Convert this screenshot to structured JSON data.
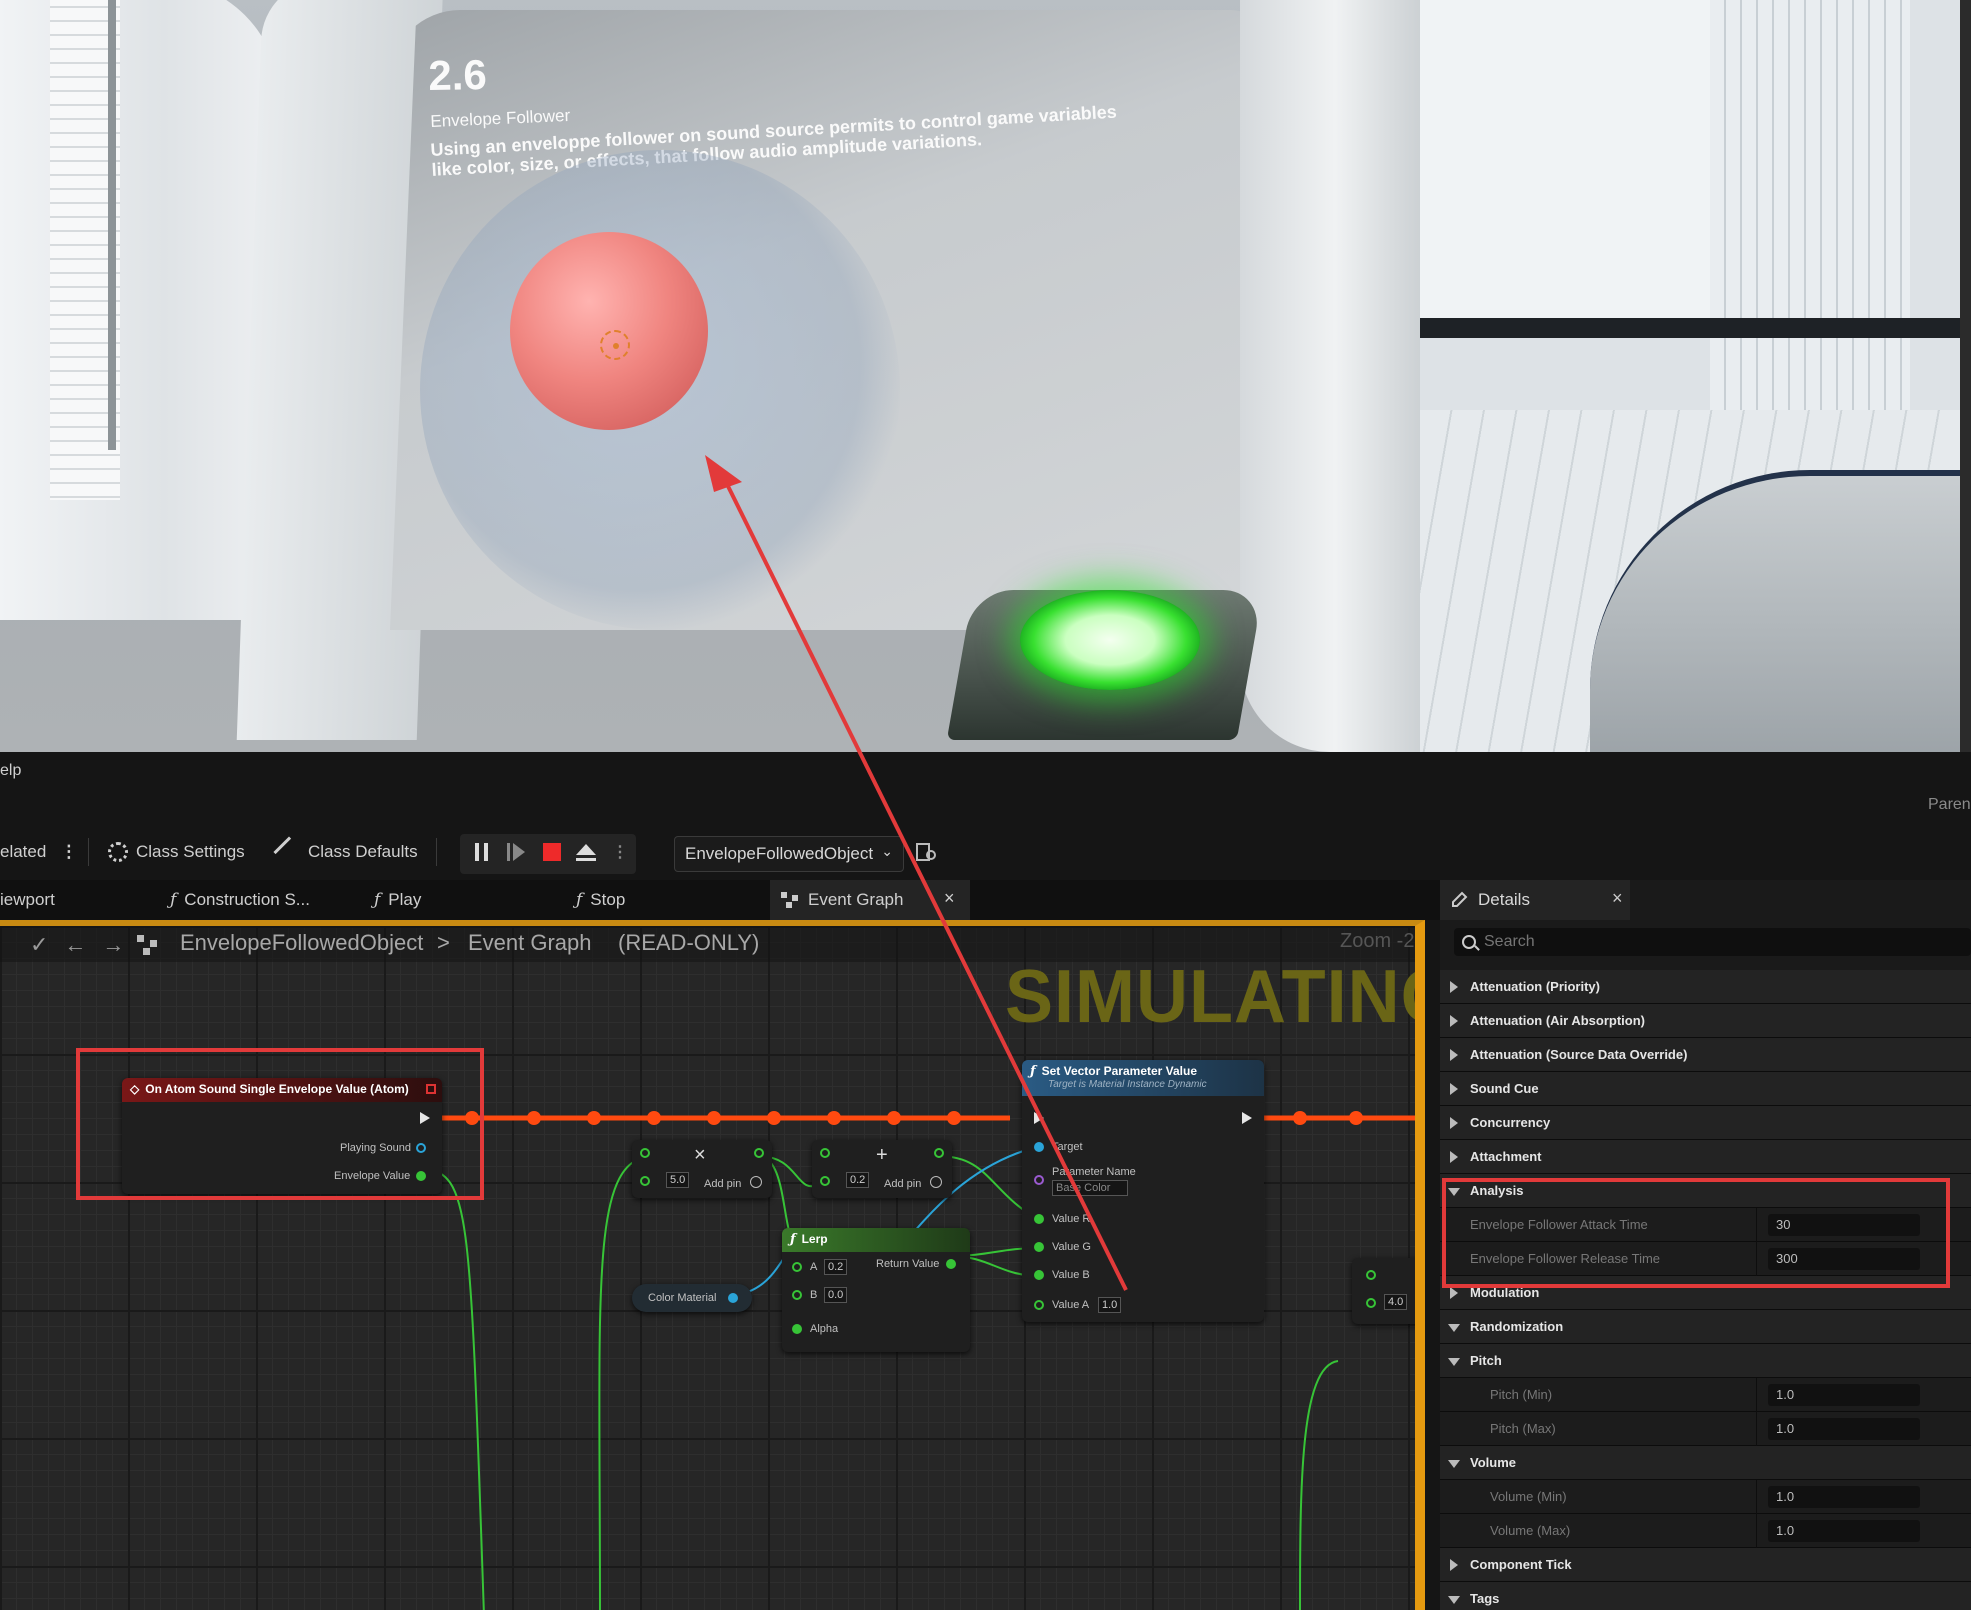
{
  "scene": {
    "number": "2.6",
    "title": "Envelope Follower",
    "description": "Using an enveloppe follower on sound source permits to control game variables like color, size, or effects, that follow audio amplitude variations."
  },
  "menu": {
    "help": "elp",
    "parent": "Paren"
  },
  "toolbar": {
    "related": "elated",
    "class_settings": "Class Settings",
    "class_defaults": "Class Defaults",
    "debug_object": "EnvelopeFollowedObject"
  },
  "tabs": [
    {
      "label": "iewport",
      "icon": "viewport-icon"
    },
    {
      "label": "Construction S...",
      "icon": "function-icon"
    },
    {
      "label": "Play",
      "icon": "function-icon"
    },
    {
      "label": "Stop",
      "icon": "function-icon"
    },
    {
      "label": "Event Graph",
      "icon": "graph-icon",
      "active": true
    }
  ],
  "breadcrumb": {
    "blueprint": "EnvelopeFollowedObject",
    "separator": ">",
    "graph": "Event Graph",
    "mode": "(READ-ONLY)",
    "zoom": "Zoom -2"
  },
  "graph": {
    "simulating_label": "SIMULATING",
    "nodes": {
      "event": {
        "title": "On Atom Sound Single Envelope Value (Atom)",
        "pins": [
          "Playing Sound",
          "Envelope Value"
        ]
      },
      "multiply": {
        "symbol": "×",
        "value": "5.0",
        "add_pin": "Add pin"
      },
      "add": {
        "symbol": "+",
        "value": "0.2",
        "add_pin": "Add pin"
      },
      "lerp": {
        "title": "Lerp",
        "pins": {
          "a": "A",
          "a_val": "0.2",
          "b": "B",
          "b_val": "0.0",
          "alpha": "Alpha",
          "ret": "Return Value"
        }
      },
      "color_material": {
        "label": "Color Material"
      },
      "set_vector": {
        "title": "Set Vector Parameter Value",
        "subtitle": "Target is Material Instance Dynamic",
        "pins": {
          "target": "Target",
          "param_name": "Parameter Name",
          "param_value": "Base Color",
          "r": "Value R",
          "g": "Value G",
          "b": "Value B",
          "a": "Value A",
          "a_val": "1.0"
        }
      },
      "partial": {
        "value": "4.0"
      }
    }
  },
  "details": {
    "tab_label": "Details",
    "search_placeholder": "Search",
    "rows": [
      {
        "type": "cat",
        "label": "Attenuation (Priority)",
        "open": false
      },
      {
        "type": "cat",
        "label": "Attenuation (Air Absorption)",
        "open": false
      },
      {
        "type": "cat",
        "label": "Attenuation (Source Data Override)",
        "open": false
      },
      {
        "type": "cat",
        "label": "Sound Cue",
        "open": false
      },
      {
        "type": "cat",
        "label": "Concurrency",
        "open": false
      },
      {
        "type": "cat",
        "label": "Attachment",
        "open": false
      },
      {
        "type": "cat",
        "label": "Analysis",
        "open": true
      },
      {
        "type": "prop",
        "label": "Envelope Follower Attack Time",
        "value": "30"
      },
      {
        "type": "prop",
        "label": "Envelope Follower Release Time",
        "value": "300"
      },
      {
        "type": "cat",
        "label": "Modulation",
        "open": false
      },
      {
        "type": "cat",
        "label": "Randomization",
        "open": true
      },
      {
        "type": "cat2",
        "label": "Pitch",
        "open": true
      },
      {
        "type": "sub",
        "label": "Pitch (Min)",
        "value": "1.0"
      },
      {
        "type": "sub",
        "label": "Pitch (Max)",
        "value": "1.0"
      },
      {
        "type": "cat2",
        "label": "Volume",
        "open": true
      },
      {
        "type": "sub",
        "label": "Volume (Min)",
        "value": "1.0"
      },
      {
        "type": "sub",
        "label": "Volume (Max)",
        "value": "1.0"
      },
      {
        "type": "cat",
        "label": "Component Tick",
        "open": false
      },
      {
        "type": "cat",
        "label": "Tags",
        "open": true
      }
    ]
  },
  "colors": {
    "annotation": "#e23a3a",
    "simulating_border": "#e59a10",
    "exec_wire": "#ff4a10",
    "float_wire": "#37c437"
  }
}
